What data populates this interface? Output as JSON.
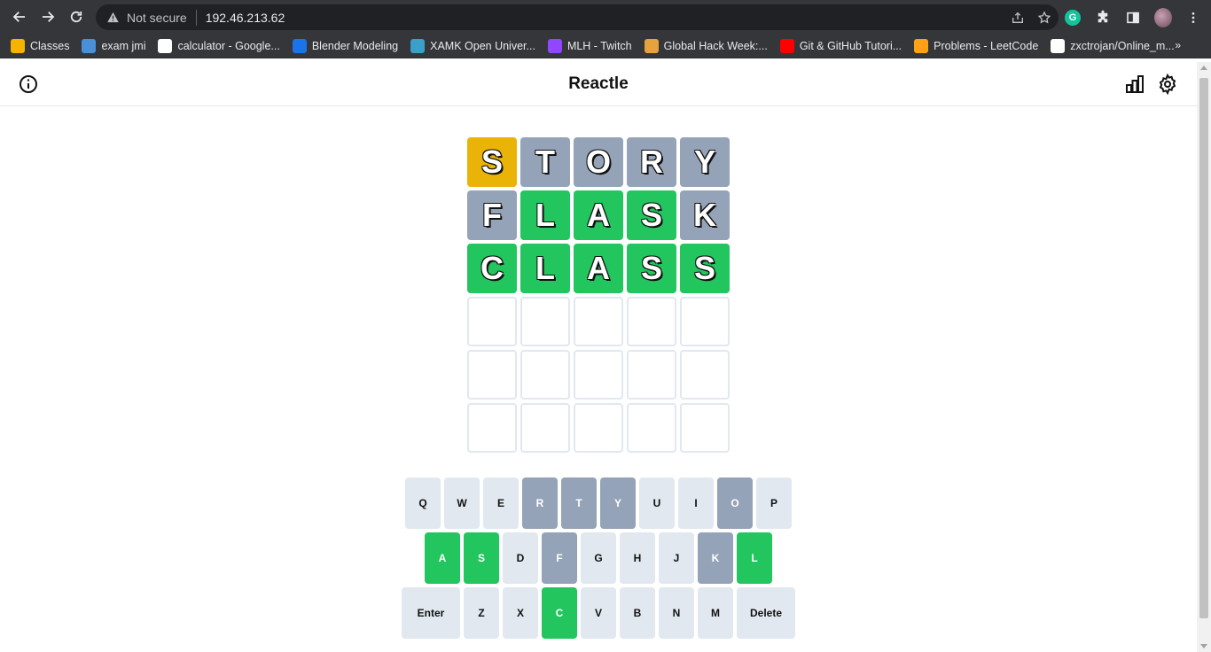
{
  "browser": {
    "security_label": "Not secure",
    "url": "192.46.213.62",
    "profile_extension_letter": "G"
  },
  "bookmarks": [
    {
      "label": "Classes",
      "icon": "classroom-icon",
      "color": "#f4b400"
    },
    {
      "label": "exam jmi",
      "icon": "feather-icon",
      "color": "#4a90d9"
    },
    {
      "label": "calculator - Google...",
      "icon": "google-icon",
      "color": "#ffffff"
    },
    {
      "label": "Blender Modeling",
      "icon": "translate-icon",
      "color": "#1a73e8"
    },
    {
      "label": "XAMK Open Univer...",
      "icon": "xamk-icon",
      "color": "#3aa0c8"
    },
    {
      "label": "MLH - Twitch",
      "icon": "twitch-icon",
      "color": "#9146ff"
    },
    {
      "label": "Global Hack Week:...",
      "icon": "ghw-icon",
      "color": "#e6a23c"
    },
    {
      "label": "Git & GitHub Tutori...",
      "icon": "youtube-icon",
      "color": "#ff0000"
    },
    {
      "label": "Problems - LeetCode",
      "icon": "leetcode-icon",
      "color": "#ffa116"
    },
    {
      "label": "zxctrojan/Online_m...",
      "icon": "github-icon",
      "color": "#ffffff"
    }
  ],
  "bookmarks_more": "»",
  "app": {
    "title": "Reactle"
  },
  "colors": {
    "correct": "#22c55e",
    "present": "#eab308",
    "absent": "#94a3b8",
    "key_default": "#e2e8f0"
  },
  "grid": [
    [
      {
        "l": "S",
        "s": "present"
      },
      {
        "l": "T",
        "s": "absent"
      },
      {
        "l": "O",
        "s": "absent"
      },
      {
        "l": "R",
        "s": "absent"
      },
      {
        "l": "Y",
        "s": "absent"
      }
    ],
    [
      {
        "l": "F",
        "s": "absent"
      },
      {
        "l": "L",
        "s": "correct"
      },
      {
        "l": "A",
        "s": "correct"
      },
      {
        "l": "S",
        "s": "correct"
      },
      {
        "l": "K",
        "s": "absent"
      }
    ],
    [
      {
        "l": "C",
        "s": "correct"
      },
      {
        "l": "L",
        "s": "correct"
      },
      {
        "l": "A",
        "s": "correct"
      },
      {
        "l": "S",
        "s": "correct"
      },
      {
        "l": "S",
        "s": "correct"
      }
    ],
    [
      {
        "l": "",
        "s": "empty"
      },
      {
        "l": "",
        "s": "empty"
      },
      {
        "l": "",
        "s": "empty"
      },
      {
        "l": "",
        "s": "empty"
      },
      {
        "l": "",
        "s": "empty"
      }
    ],
    [
      {
        "l": "",
        "s": "empty"
      },
      {
        "l": "",
        "s": "empty"
      },
      {
        "l": "",
        "s": "empty"
      },
      {
        "l": "",
        "s": "empty"
      },
      {
        "l": "",
        "s": "empty"
      }
    ],
    [
      {
        "l": "",
        "s": "empty"
      },
      {
        "l": "",
        "s": "empty"
      },
      {
        "l": "",
        "s": "empty"
      },
      {
        "l": "",
        "s": "empty"
      },
      {
        "l": "",
        "s": "empty"
      }
    ]
  ],
  "keyboard": [
    [
      {
        "k": "Q",
        "s": ""
      },
      {
        "k": "W",
        "s": ""
      },
      {
        "k": "E",
        "s": ""
      },
      {
        "k": "R",
        "s": "absent"
      },
      {
        "k": "T",
        "s": "absent"
      },
      {
        "k": "Y",
        "s": "absent"
      },
      {
        "k": "U",
        "s": ""
      },
      {
        "k": "I",
        "s": ""
      },
      {
        "k": "O",
        "s": "absent"
      },
      {
        "k": "P",
        "s": ""
      }
    ],
    [
      {
        "k": "A",
        "s": "correct"
      },
      {
        "k": "S",
        "s": "correct"
      },
      {
        "k": "D",
        "s": ""
      },
      {
        "k": "F",
        "s": "absent"
      },
      {
        "k": "G",
        "s": ""
      },
      {
        "k": "H",
        "s": ""
      },
      {
        "k": "J",
        "s": ""
      },
      {
        "k": "K",
        "s": "absent"
      },
      {
        "k": "L",
        "s": "correct"
      }
    ],
    [
      {
        "k": "Enter",
        "s": "",
        "wide": true
      },
      {
        "k": "Z",
        "s": ""
      },
      {
        "k": "X",
        "s": ""
      },
      {
        "k": "C",
        "s": "correct"
      },
      {
        "k": "V",
        "s": ""
      },
      {
        "k": "B",
        "s": ""
      },
      {
        "k": "N",
        "s": ""
      },
      {
        "k": "M",
        "s": ""
      },
      {
        "k": "Delete",
        "s": "",
        "wide": true
      }
    ]
  ]
}
